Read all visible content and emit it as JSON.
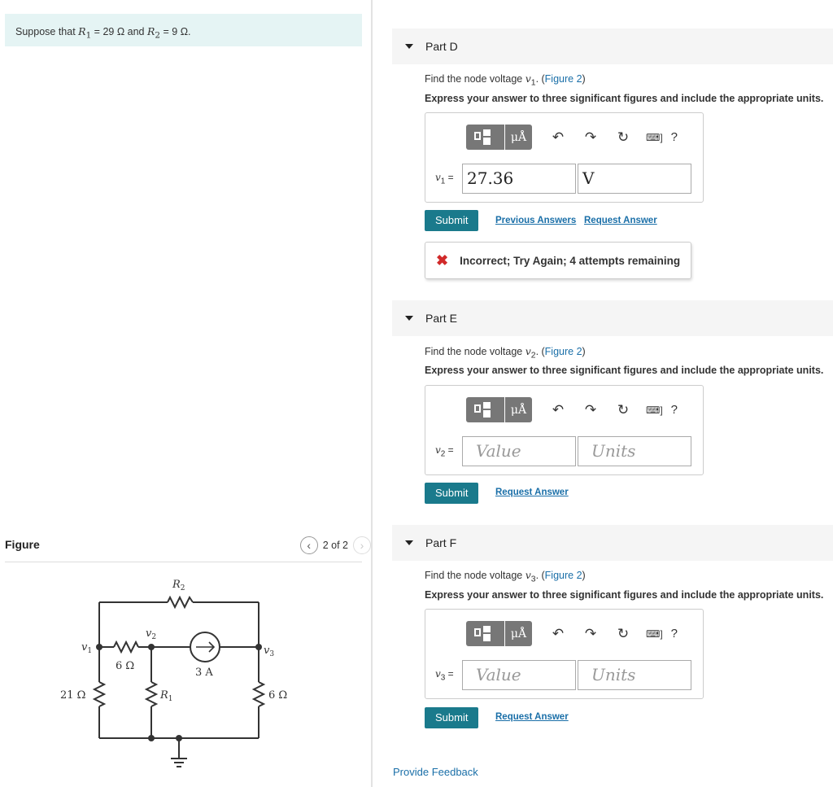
{
  "problem": {
    "prefix": "Suppose that ",
    "r1_sym": "R",
    "r1_sub": "1",
    "r1_val": " = 29 Ω",
    "mid": " and ",
    "r2_sym": "R",
    "r2_sub": "2",
    "r2_val": " = 9 Ω",
    "suffix": "."
  },
  "figure": {
    "title": "Figure",
    "counter": "2 of 2",
    "prev_icon": "chevron-left-icon",
    "next_icon": "chevron-right-icon",
    "labels": {
      "r2": "R",
      "r2_sub": "2",
      "v1": "v",
      "v1_sub": "1",
      "v2": "v",
      "v2_sub": "2",
      "v3": "v",
      "v3_sub": "3",
      "six_ohm_top": "6 Ω",
      "three_amp": "3 A",
      "twentyone_ohm": "21 Ω",
      "r1": "R",
      "r1_sub": "1",
      "six_ohm_right": "6 Ω"
    }
  },
  "toolbar": {
    "unit_label": "μÅ",
    "undo_icon": "undo-icon",
    "redo_icon": "redo-icon",
    "reset_icon": "reset-icon",
    "keyboard_icon": "keyboard-icon",
    "help_label": "?"
  },
  "parts": {
    "d": {
      "title": "Part D",
      "question_prefix": "Find the node voltage ",
      "var": "v",
      "var_sub": "1",
      "question_mid": ". (",
      "figure_link": "Figure 2",
      "question_suffix": ")",
      "instructions": "Express your answer to three significant figures and include the appropriate units.",
      "var_label_suffix": " =",
      "value": "27.36",
      "units": "V",
      "submit": "Submit",
      "previous_answers": "Previous Answers",
      "request_answer": "Request Answer",
      "feedback": "Incorrect; Try Again; 4 attempts remaining"
    },
    "e": {
      "title": "Part E",
      "question_prefix": "Find the node voltage ",
      "var": "v",
      "var_sub": "2",
      "question_mid": ". (",
      "figure_link": "Figure 2",
      "question_suffix": ")",
      "instructions": "Express your answer to three significant figures and include the appropriate units.",
      "var_label_suffix": " =",
      "value_placeholder": "Value",
      "units_placeholder": "Units",
      "submit": "Submit",
      "request_answer": "Request Answer"
    },
    "f": {
      "title": "Part F",
      "question_prefix": "Find the node voltage ",
      "var": "v",
      "var_sub": "3",
      "question_mid": ". (",
      "figure_link": "Figure 2",
      "question_suffix": ")",
      "instructions": "Express your answer to three significant figures and include the appropriate units.",
      "var_label_suffix": " =",
      "value_placeholder": "Value",
      "units_placeholder": "Units",
      "submit": "Submit",
      "request_answer": "Request Answer"
    }
  },
  "footer": {
    "provide_feedback": "Provide Feedback"
  },
  "colors": {
    "accent": "#1a7a8c",
    "link": "#1a6fa8",
    "problem_bg": "#e5f4f4",
    "error": "#d12a2a"
  }
}
